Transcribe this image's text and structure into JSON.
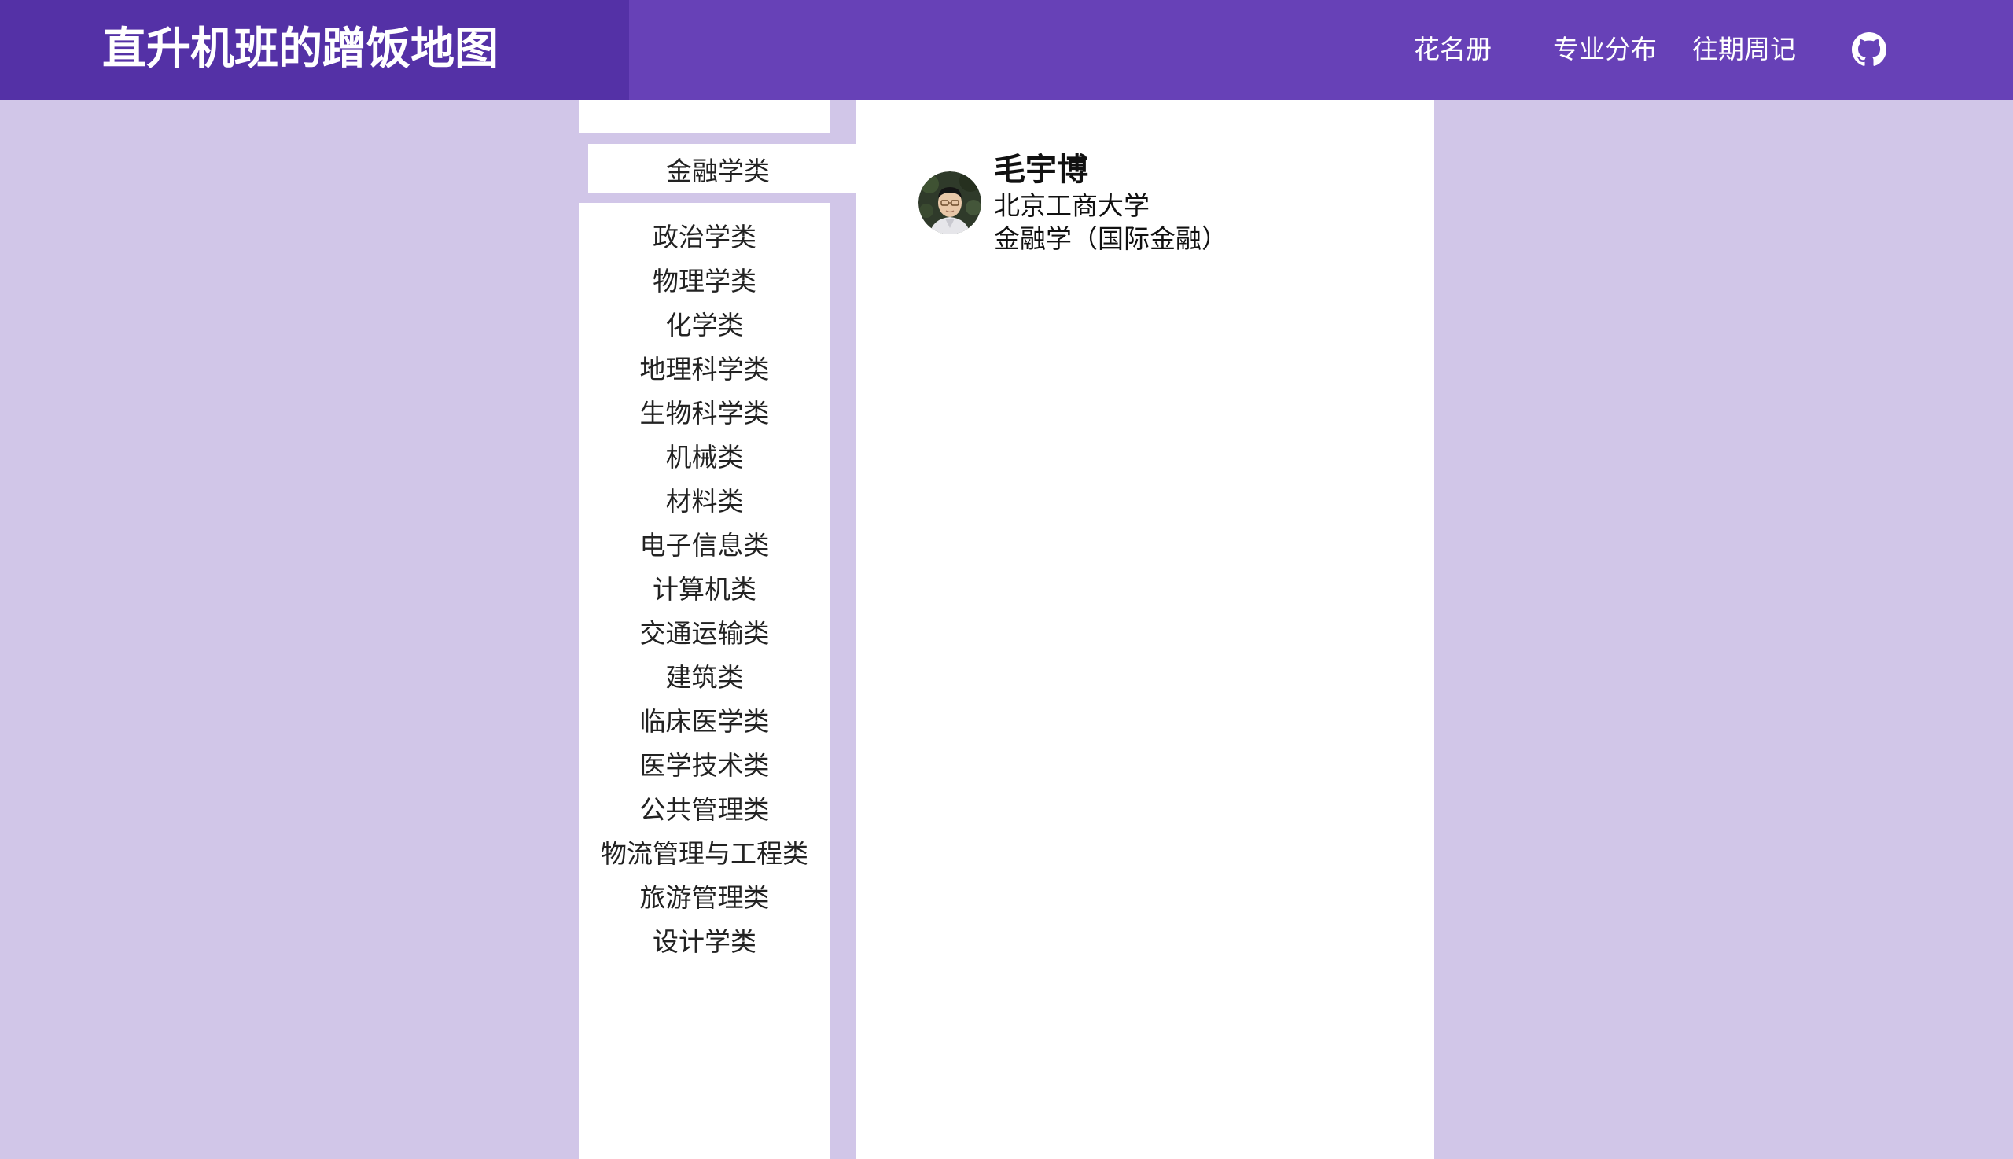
{
  "header": {
    "title": "直升机班的蹭饭地图",
    "nav": [
      {
        "label": "花名册"
      },
      {
        "label": "专业分布"
      },
      {
        "label": "往期周记"
      }
    ],
    "github_icon": "github-icon"
  },
  "sidebar": {
    "active_item": "金融学类",
    "items": [
      "政治学类",
      "物理学类",
      "化学类",
      "地理科学类",
      "生物科学类",
      "机械类",
      "材料类",
      "电子信息类",
      "计算机类",
      "交通运输类",
      "建筑类",
      "临床医学类",
      "医学技术类",
      "公共管理类",
      "物流管理与工程类",
      "旅游管理类",
      "设计学类"
    ]
  },
  "main": {
    "people": [
      {
        "name": "毛宇博",
        "school": "北京工商大学",
        "major": "金融学（国际金融）",
        "avatar": "avatar-photo"
      }
    ]
  },
  "colors": {
    "header_bg": "#6741b7",
    "brand_bg": "#5431a6",
    "page_bg": "#d1c6e8",
    "panel_bg": "#ffffff"
  }
}
